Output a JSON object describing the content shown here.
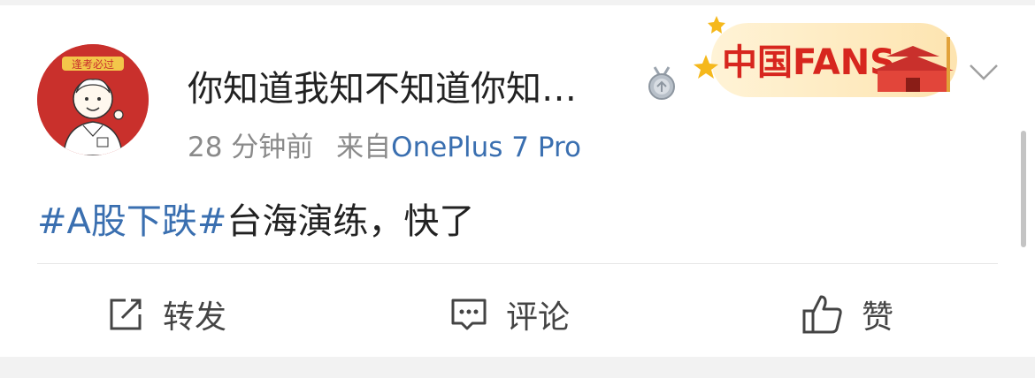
{
  "post": {
    "username": "你知道我知不知道你知…",
    "medal_icon": "medal-icon",
    "time": "28 分钟前",
    "from_label": "来自",
    "device": "OnePlus 7 Pro",
    "content": {
      "topic": "#A股下跌#",
      "text": "台海演练，快了"
    },
    "badge_banner": {
      "text": "中国FANS",
      "icon": "tiananmen-icon"
    },
    "avatar_caption": "逢考必过",
    "menu_icon": "chevron-down-icon"
  },
  "actions": {
    "repost": {
      "label": "转发",
      "icon": "share-icon"
    },
    "comment": {
      "label": "评论",
      "icon": "comment-icon"
    },
    "like": {
      "label": "赞",
      "icon": "thumbs-up-icon"
    }
  },
  "colors": {
    "link": "#3a6fb0",
    "text": "#222222",
    "meta": "#8a8a8a",
    "avatar_bg": "#c9302c",
    "banner_red": "#d7261e"
  }
}
